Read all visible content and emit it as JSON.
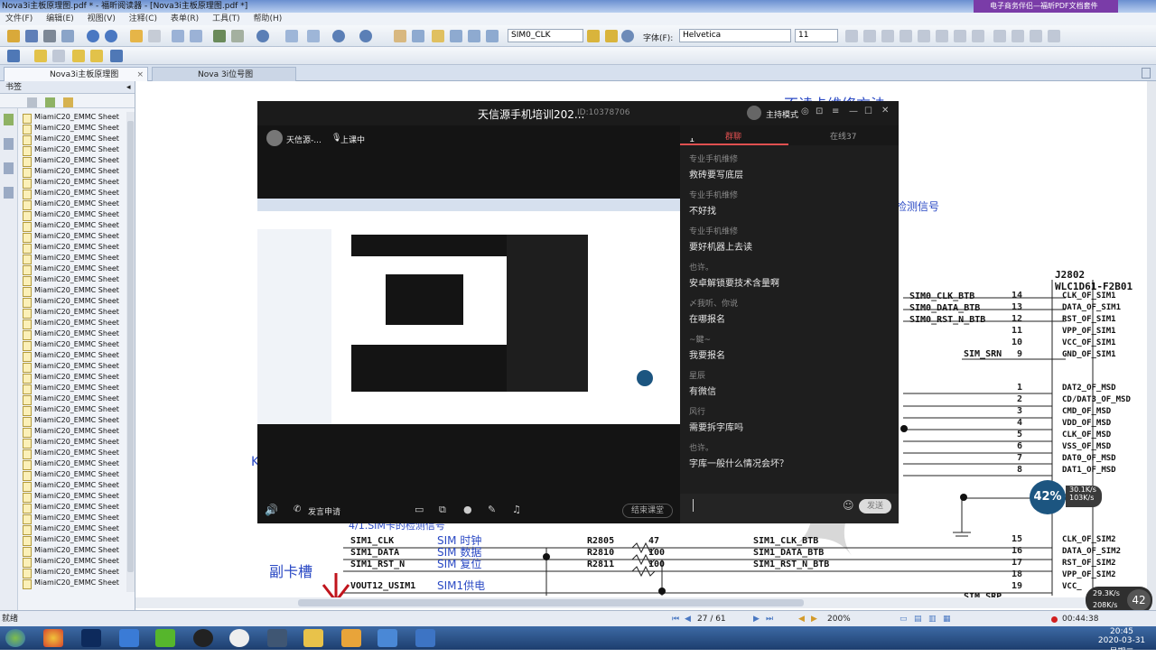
{
  "window": {
    "title": "Nova3i主板原理图.pdf * - 福昕阅读器 - [Nova3i主板原理图.pdf *]",
    "ad": "电子商务伴侣—福昕PDF文档套件"
  },
  "menu": [
    "文件(F)",
    "编辑(E)",
    "视图(V)",
    "注释(C)",
    "表单(R)",
    "工具(T)",
    "帮助(H)"
  ],
  "toolbar": {
    "field_name": "SIM0_CLK",
    "font_label": "字体(F):",
    "font_value": "Helvetica",
    "font_size": "11"
  },
  "tabs": [
    "Nova3i主板原理图",
    "Nova 3i位号图"
  ],
  "sidebar": {
    "title": "书签",
    "items": [
      "MiamiC20_EMMC Sheet",
      "MiamiC20_EMMC Sheet",
      "MiamiC20_EMMC Sheet",
      "MiamiC20_EMMC Sheet",
      "MiamiC20_EMMC Sheet",
      "MiamiC20_EMMC Sheet",
      "MiamiC20_EMMC Sheet",
      "MiamiC20_EMMC Sheet",
      "MiamiC20_EMMC Sheet",
      "MiamiC20_EMMC Sheet",
      "MiamiC20_EMMC Sheet",
      "MiamiC20_EMMC Sheet",
      "MiamiC20_EMMC Sheet",
      "MiamiC20_EMMC Sheet",
      "MiamiC20_EMMC Sheet",
      "MiamiC20_EMMC Sheet",
      "MiamiC20_EMMC Sheet",
      "MiamiC20_EMMC Sheet",
      "MiamiC20_EMMC Sheet",
      "MiamiC20_EMMC Sheet",
      "MiamiC20_EMMC Sheet",
      "MiamiC20_EMMC Sheet",
      "MiamiC20_EMMC Sheet",
      "MiamiC20_EMMC Sheet",
      "MiamiC20_EMMC Sheet",
      "MiamiC20_EMMC Sheet",
      "MiamiC20_EMMC Sheet",
      "MiamiC20_EMMC Sheet",
      "MiamiC20_EMMC Sheet",
      "MiamiC20_EMMC Sheet",
      "MiamiC20_EMMC Sheet",
      "MiamiC20_EMMC Sheet",
      "MiamiC20_EMMC Sheet",
      "MiamiC20_EMMC Sheet",
      "MiamiC20_EMMC Sheet",
      "MiamiC20_EMMC Sheet",
      "MiamiC20_EMMC Sheet",
      "MiamiC20_EMMC Sheet",
      "MiamiC20_EMMC Sheet",
      "MiamiC20_EMMC Sheet",
      "MiamiC20_EMMC Sheet",
      "MiamiC20_EMMC Sheet",
      "MiamiC20_EMMC Sheet",
      "MiamiC20_EMMC Sheet"
    ]
  },
  "schematic": {
    "heading_right": "不读卡维修方法",
    "blue_note": "检测信号",
    "connector": "J2802",
    "connector_part": "WLC1D61-F2B01",
    "nets_top": [
      "SIM0_CLK_BTB",
      "SIM0_DATA_BTB",
      "SIM0_RST_N_BTB",
      "SIM_SRN"
    ],
    "pins": [
      {
        "n": "14",
        "name": "CLK_OF_SIM1"
      },
      {
        "n": "13",
        "name": "DATA_OF_SIM1"
      },
      {
        "n": "12",
        "name": "RST_OF_SIM1"
      },
      {
        "n": "11",
        "name": "VPP_OF_SIM1"
      },
      {
        "n": "10",
        "name": "VCC_OF_SIM1"
      },
      {
        "n": "9",
        "name": "GND_OF_SIM1"
      },
      {
        "n": "1",
        "name": "DAT2_OF_MSD"
      },
      {
        "n": "2",
        "name": "CD/DAT3_OF_MSD"
      },
      {
        "n": "3",
        "name": "CMD_OF_MSD"
      },
      {
        "n": "4",
        "name": "VDD_OF_MSD"
      },
      {
        "n": "5",
        "name": "CLK_OF_MSD"
      },
      {
        "n": "6",
        "name": "VSS_OF_MSD"
      },
      {
        "n": "7",
        "name": "DAT0_OF_MSD"
      },
      {
        "n": "8",
        "name": "DAT1_OF_MSD"
      },
      {
        "n": "",
        "name": "SW/CD"
      },
      {
        "n": "15",
        "name": "CLK_OF_SIM2"
      },
      {
        "n": "16",
        "name": "DATA_OF_SIM2"
      },
      {
        "n": "17",
        "name": "RST_OF_SIM2"
      },
      {
        "n": "18",
        "name": "VPP_OF_SIM2"
      },
      {
        "n": "19",
        "name": "VCC_"
      }
    ],
    "sim_section": "4/1.SIM卡的检测信号",
    "sim_rows": [
      {
        "sig": "SIM1_CLK",
        "cn": "SIM 时钟",
        "r": "R2805",
        "v": "47",
        "btb": "SIM1_CLK_BTB"
      },
      {
        "sig": "SIM1_DATA",
        "cn": "SIM 数据",
        "r": "R2810",
        "v": "100",
        "btb": "SIM1_DATA_BTB"
      },
      {
        "sig": "SIM1_RST_N",
        "cn": "SIM 复位",
        "r": "R2811",
        "v": "100",
        "btb": "SIM1_RST_N_BTB"
      },
      {
        "sig": "VOUT12_USIM1",
        "cn": "SIM1供电",
        "r": "",
        "v": "",
        "btb": ""
      }
    ],
    "side_label": "副卡槽",
    "bottom_net": "SIM_SRP",
    "left_letter": "K"
  },
  "video": {
    "title": "天信源手机培训202...",
    "id": "ID:10378706",
    "host_label": "主持模式",
    "presenter": "天信源-...",
    "status": "上课中",
    "tabs": [
      "群聊",
      "在线37"
    ],
    "controls": {
      "mic_request": "发言申请",
      "end": "结束课堂",
      "send": "发送"
    },
    "messages": [
      {
        "name": "",
        "text": "1"
      },
      {
        "name": "专业手机维修",
        "text": "救砖要写底层"
      },
      {
        "name": "专业手机维修",
        "text": "不好找"
      },
      {
        "name": "专业手机维修",
        "text": "要好机器上去读"
      },
      {
        "name": "也许。",
        "text": "安卓解锁要技术含量啊"
      },
      {
        "name": "〆我听、你说",
        "text": "在哪报名"
      },
      {
        "name": "~鍵~",
        "text": "我要报名"
      },
      {
        "name": "星辰",
        "text": "有微信"
      },
      {
        "name": "风行",
        "text": "需要拆字库吗"
      },
      {
        "name": "也许。",
        "text": "字库一般什么情况会坏？"
      }
    ]
  },
  "overlay": {
    "pct": "42%",
    "up": "30.1K/s",
    "down": "103K/s",
    "pct2": "42",
    "up2": "29.3K/s",
    "down2": "208K/s"
  },
  "status": {
    "left": "就绪",
    "page": "27 / 61",
    "zoom": "200%",
    "rec_time": "00:44:38"
  },
  "clock": {
    "time": "20:45",
    "date": "2020-03-31 星期二"
  },
  "colors": {
    "accent": "#2a49c4",
    "chat_active": "#e05050",
    "bubble": "#1c5580"
  }
}
